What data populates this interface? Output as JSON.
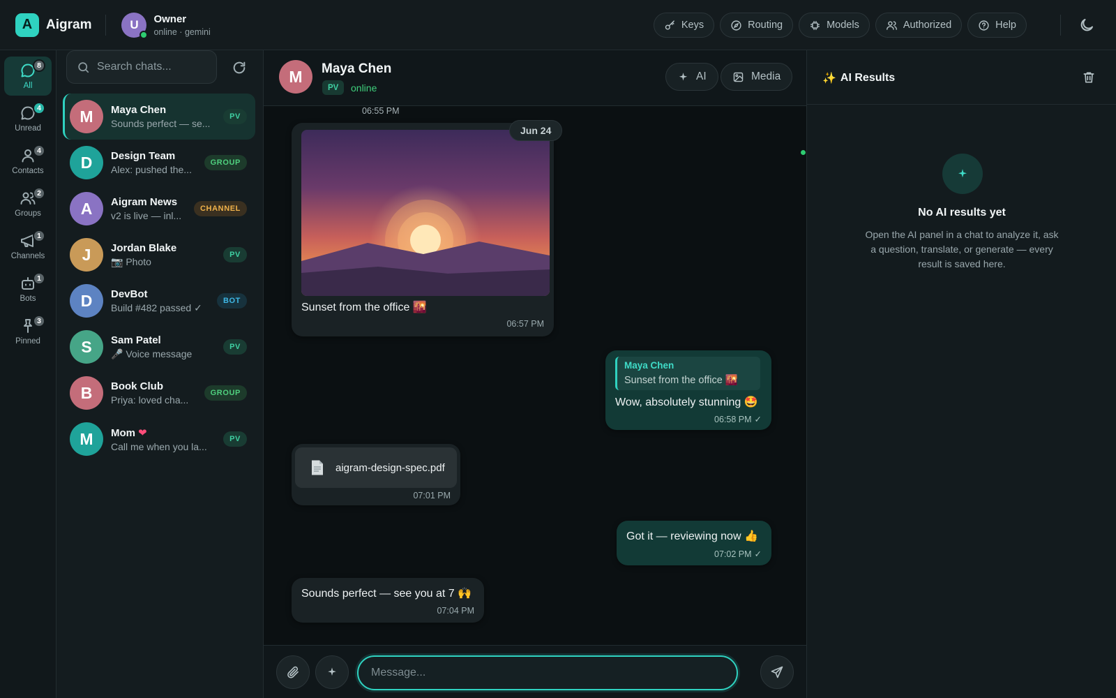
{
  "app": {
    "logo_letter": "A",
    "name": "Aigram"
  },
  "owner": {
    "avatar_letter": "U",
    "name": "Owner",
    "status": "online · gemini"
  },
  "top_actions": [
    {
      "label": "Keys",
      "icon": "key-icon"
    },
    {
      "label": "Routing",
      "icon": "compass-icon"
    },
    {
      "label": "Models",
      "icon": "chip-icon"
    },
    {
      "label": "Authorized",
      "icon": "users-icon"
    },
    {
      "label": "Help",
      "icon": "help-icon"
    }
  ],
  "theme_toggle_icon": "moon-icon",
  "rail": [
    {
      "label": "All",
      "badge": "8",
      "icon": "chat-bubble-icon",
      "active": true
    },
    {
      "label": "Unread",
      "badge": "4",
      "icon": "chat-unread-icon"
    },
    {
      "label": "Contacts",
      "badge": "4",
      "icon": "person-icon"
    },
    {
      "label": "Groups",
      "badge": "2",
      "icon": "group-icon"
    },
    {
      "label": "Channels",
      "badge": "1",
      "icon": "megaphone-icon"
    },
    {
      "label": "Bots",
      "badge": "1",
      "icon": "robot-icon"
    },
    {
      "label": "Pinned",
      "badge": "3",
      "icon": "pin-icon"
    }
  ],
  "search": {
    "placeholder": "Search chats..."
  },
  "chats": [
    {
      "avatar": "M",
      "color": "#c46d7a",
      "name": "Maya Chen",
      "preview": "Sounds perfect — se...",
      "tag": "PV",
      "tag_type": "pv",
      "active": true
    },
    {
      "avatar": "D",
      "color": "#1fa39a",
      "name": "Design Team",
      "preview": "Alex: pushed the...",
      "tag": "GROUP",
      "tag_type": "group"
    },
    {
      "avatar": "A",
      "color": "#8a73c3",
      "name": "Aigram News",
      "preview": "v2 is live — inl...",
      "tag": "CHANNEL",
      "tag_type": "channel"
    },
    {
      "avatar": "J",
      "color": "#c99a58",
      "name": "Jordan Blake",
      "preview": "📷 Photo",
      "tag": "PV",
      "tag_type": "pv"
    },
    {
      "avatar": "D",
      "color": "#5d83c2",
      "name": "DevBot",
      "preview": "Build #482 passed ✓",
      "tag": "BOT",
      "tag_type": "bot"
    },
    {
      "avatar": "S",
      "color": "#46a587",
      "name": "Sam Patel",
      "preview": "🎤 Voice message",
      "tag": "PV",
      "tag_type": "pv"
    },
    {
      "avatar": "B",
      "color": "#c46d7a",
      "name": "Book Club",
      "preview": "Priya: loved cha...",
      "tag": "GROUP",
      "tag_type": "group"
    },
    {
      "avatar": "M",
      "color": "#1fa39a",
      "name": "Mom",
      "name_suffix": "❤",
      "preview": "Call me when you la...",
      "tag": "PV",
      "tag_type": "pv"
    }
  ],
  "conversation": {
    "avatar": "M",
    "name": "Maya Chen",
    "type": "PV",
    "status": "online",
    "actions": {
      "ai": "AI",
      "media": "Media"
    },
    "top_time": "06:55 PM",
    "date_chip": "Jun 24",
    "messages": {
      "photo": {
        "caption": "Sunset from the office 🌇",
        "time": "06:57 PM"
      },
      "reply": {
        "quote_name": "Maya Chen",
        "quote_text": "Sunset from the office 🌇",
        "text": "Wow, absolutely stunning 🤩",
        "time": "06:58 PM",
        "check": "✓"
      },
      "file": {
        "filename": "aigram-design-spec.pdf",
        "time": "07:01 PM"
      },
      "got_it": {
        "text": "Got it — reviewing now 👍",
        "time": "07:02 PM",
        "check": "✓"
      },
      "perfect": {
        "text": "Sounds perfect — see you at 7 🙌",
        "time": "07:04 PM"
      }
    },
    "composer": {
      "placeholder": "Message..."
    }
  },
  "ai_results": {
    "title": "AI Results",
    "title_icon": "✨",
    "empty_title": "No AI results yet",
    "empty_text": "Open the AI panel in a chat to analyze it, ask a question, translate, or generate — every result is saved here."
  },
  "colors": {
    "accent": "#2fd2c0",
    "online": "#2ecc71",
    "background": "#0d1214"
  }
}
